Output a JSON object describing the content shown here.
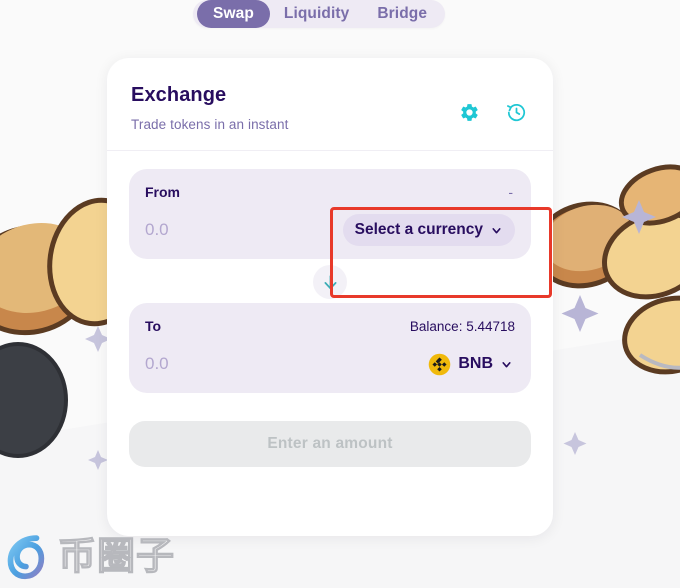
{
  "page": {
    "background_color": "#fafafa",
    "brand_purple": "#7a6eaa",
    "brand_dark": "#280d5f",
    "accent_teal": "#1fc7d4",
    "annotation_color": "#e8392a"
  },
  "tabs": [
    {
      "label": "Swap",
      "active": true
    },
    {
      "label": "Liquidity",
      "active": false
    },
    {
      "label": "Bridge",
      "active": false
    }
  ],
  "card": {
    "title": "Exchange",
    "subtitle": "Trade tokens in an instant",
    "icons": [
      {
        "name": "gear-icon",
        "label": "Settings"
      },
      {
        "name": "history-icon",
        "label": "Recent transactions"
      }
    ]
  },
  "from_panel": {
    "label": "From",
    "meta": "-",
    "amount_value": "",
    "amount_placeholder": "0.0",
    "currency_label": "Select a currency",
    "chevron": "chevron-down-icon"
  },
  "swap_button": {
    "name": "swap-direction-button",
    "icon": "arrow-down-icon"
  },
  "to_panel": {
    "label": "To",
    "meta": "Balance: 5.44718",
    "amount_value": "",
    "amount_placeholder": "0.0",
    "currency_label": "BNB",
    "token_icon": "bnb-token-icon",
    "chevron": "chevron-down-icon"
  },
  "cta": {
    "label": "Enter an amount",
    "disabled": true
  },
  "watermark": {
    "text": "币圈子"
  }
}
